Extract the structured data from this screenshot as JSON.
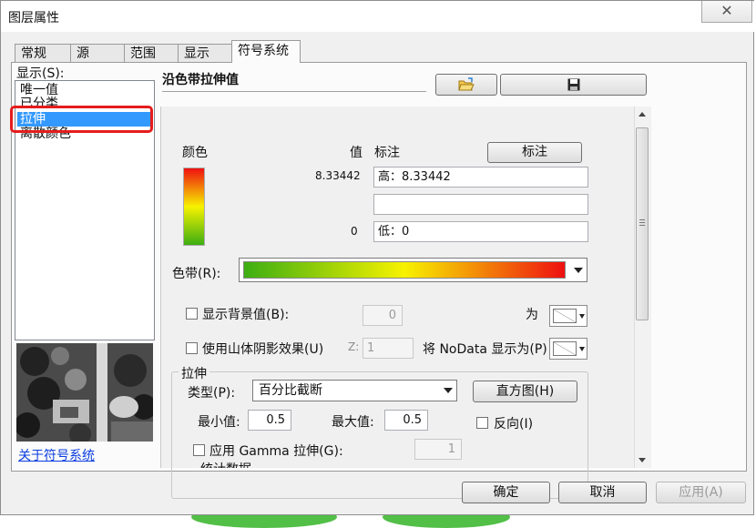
{
  "window": {
    "title": "图层属性",
    "close_glyph": "✕"
  },
  "tabs": [
    {
      "label": "常规"
    },
    {
      "label": "源"
    },
    {
      "label": "范围"
    },
    {
      "label": "显示"
    },
    {
      "label": "符号系统"
    }
  ],
  "left": {
    "show_label": "显示(S):",
    "items": [
      {
        "label": "唯一值"
      },
      {
        "label": "已分类"
      },
      {
        "label": "拉伸"
      },
      {
        "label": "离散颜色"
      }
    ],
    "about_link": "关于符号系统"
  },
  "right": {
    "section_title": "沿色带拉伸值",
    "headers": {
      "color": "颜色",
      "value": "值",
      "label": "标注"
    },
    "label_button": "标注",
    "values": {
      "high": "8.33442",
      "low": "0"
    },
    "label_fields": {
      "high": "高：8.33442",
      "middle": "",
      "low": "低：0"
    },
    "colors": {
      "ramp_low": "#3cae12",
      "ramp_mid": "#f7f200",
      "ramp_high": "#ee1010"
    },
    "color_ramp_label": "色带(R):",
    "background": {
      "label": "显示背景值(B):",
      "value": "0",
      "as_label": "为"
    },
    "hillshade": {
      "label": "使用山体阴影效果(U)",
      "z_label": "Z:",
      "z_value": "1",
      "nodata_label": "将 NoData 显示为(P)"
    },
    "stretch": {
      "group_label": "拉伸",
      "type_label": "类型(P):",
      "type_value": "百分比截断",
      "histogram_button": "直方图(H)",
      "min_label": "最小值:",
      "min_value": "0.5",
      "max_label": "最大值:",
      "max_value": "0.5",
      "invert_label": "反向(I)",
      "gamma_label": "应用 Gamma 拉伸(G):",
      "gamma_value": "1",
      "stats_label": "统计数据"
    }
  },
  "buttons": {
    "ok": "确定",
    "cancel": "取消",
    "apply": "应用(A)"
  }
}
